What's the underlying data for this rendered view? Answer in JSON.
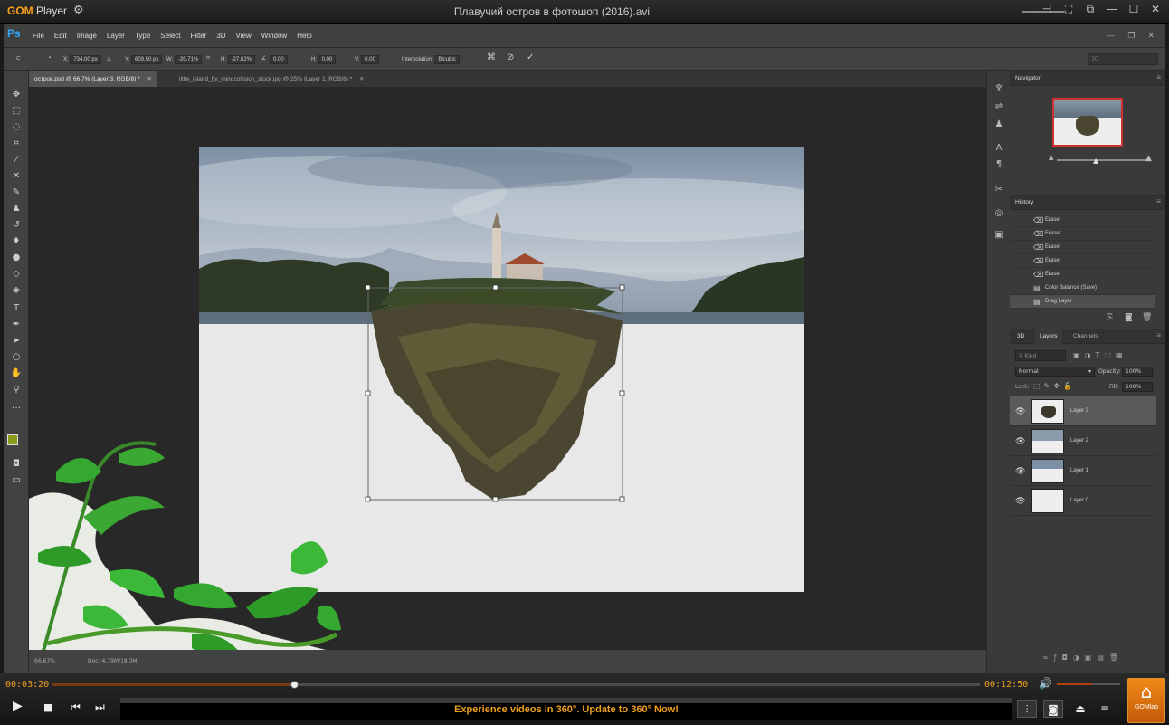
{
  "player": {
    "logo_brand": "GOM",
    "logo_product": "Player",
    "title": "Плавучий остров в фотошоп (2016).avi",
    "time_current": "00:03:20",
    "time_total": "00:12:50",
    "progress": 0.26,
    "volume": 0.55,
    "banner": "Experience videos in 360°. Update to 360° Now!",
    "gomlab_label": "GOMlab"
  },
  "photoshop": {
    "logo": "Ps",
    "menu": [
      "File",
      "Edit",
      "Image",
      "Layer",
      "Type",
      "Select",
      "Filter",
      "3D",
      "View",
      "Window",
      "Help"
    ],
    "options": {
      "x_label": "X:",
      "x_value": "734.00 px",
      "y_label": "Y:",
      "y_value": "609.50 px",
      "w_label": "W:",
      "w_value": "-35.71%",
      "h_label": "H:",
      "h_value": "-27.82%",
      "angle_value": "0.00",
      "hskew_label": "H:",
      "hskew_value": "0.00",
      "vskew_label": "V:",
      "vskew_value": "0.00",
      "interp_label": "Interpolation:",
      "interp_value": "Bicubic",
      "workspace": "3D"
    },
    "tabs": [
      {
        "label": "остров.psd @ 66,7% (Layer 3, RGB/8) *"
      },
      {
        "label": "little_island_by_mindcollision_stock.jpg @ 25% (Layer 1, RGB/8) *"
      }
    ],
    "status": {
      "zoom": "66,67%",
      "doc": "Doc: 4,79M/18,3M"
    },
    "navigator": {
      "title": "Navigator"
    },
    "history": {
      "title": "History",
      "items": [
        {
          "label": "Eraser",
          "icon": "eraser-icon"
        },
        {
          "label": "Eraser",
          "icon": "eraser-icon"
        },
        {
          "label": "Eraser",
          "icon": "eraser-icon"
        },
        {
          "label": "Eraser",
          "icon": "eraser-icon"
        },
        {
          "label": "Eraser",
          "icon": "eraser-icon"
        },
        {
          "label": "Color Balance (Save)",
          "icon": "document-icon"
        },
        {
          "label": "Drag Layer",
          "icon": "document-icon"
        }
      ]
    },
    "layers_panel": {
      "tabs": [
        "3D",
        "Layers",
        "Channels"
      ],
      "kind_placeholder": "Kind",
      "blend_mode": "Normal",
      "opacity_label": "Opacity:",
      "opacity_value": "100%",
      "lock_label": "Lock:",
      "fill_label": "Fill:",
      "fill_value": "100%",
      "layers": [
        {
          "name": "Layer 3"
        },
        {
          "name": "Layer 2"
        },
        {
          "name": "Layer 1"
        },
        {
          "name": "Layer 0"
        }
      ]
    }
  },
  "colors": {
    "accent": "#f0a020",
    "fg_swatch": "#8a9a1a",
    "ps_blue": "#31a8ff"
  }
}
